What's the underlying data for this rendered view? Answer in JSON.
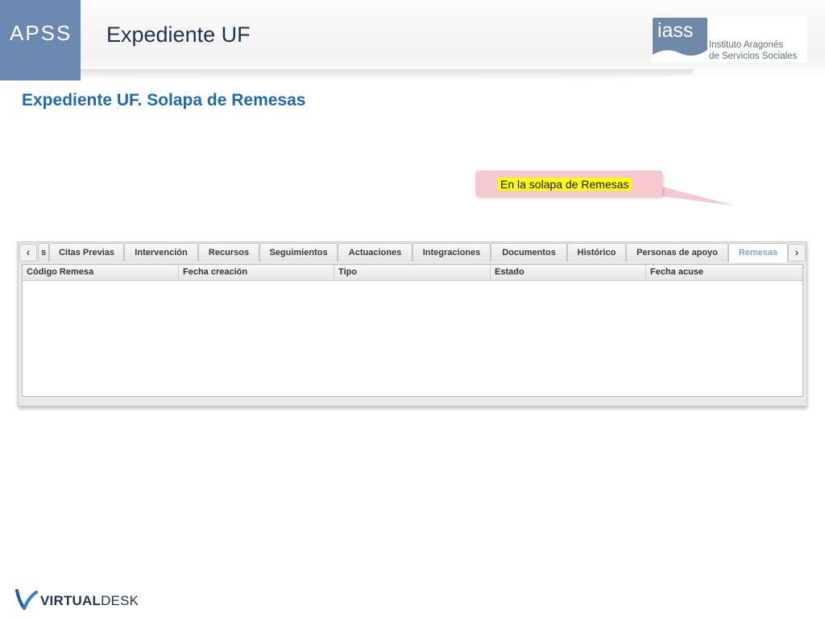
{
  "header": {
    "badge": "APSS",
    "title": "Expediente UF",
    "logo": {
      "mark_text": "iass",
      "line1": "Instituto Aragonés",
      "line2": "de Servicios Sociales"
    }
  },
  "section_title": "Expediente UF. Solapa de Remesas",
  "callout": {
    "text": "En la solapa de Remesas"
  },
  "tabs": {
    "prev_icon": "chevron-left-icon",
    "next_icon": "chevron-right-icon",
    "items": [
      {
        "label": "s"
      },
      {
        "label": "Citas Previas"
      },
      {
        "label": "Intervención"
      },
      {
        "label": "Recursos"
      },
      {
        "label": "Seguimientos"
      },
      {
        "label": "Actuaciones"
      },
      {
        "label": "Integraciones"
      },
      {
        "label": "Documentos"
      },
      {
        "label": "Histórico"
      },
      {
        "label": "Personas de apoyo"
      },
      {
        "label": "Remesas"
      }
    ],
    "active": "Remesas"
  },
  "grid": {
    "columns": [
      "Código Remesa",
      "Fecha creación",
      "Tipo",
      "Estado",
      "Fecha acuse"
    ],
    "rows": []
  },
  "footer": {
    "brand_bold": "VIRTUAL",
    "brand_rest": "DESK"
  },
  "colors": {
    "accent": "#1f6bb0",
    "badge": "#6b88b1",
    "callout_bg": "#f6c9d0",
    "highlight": "#ffff00"
  }
}
